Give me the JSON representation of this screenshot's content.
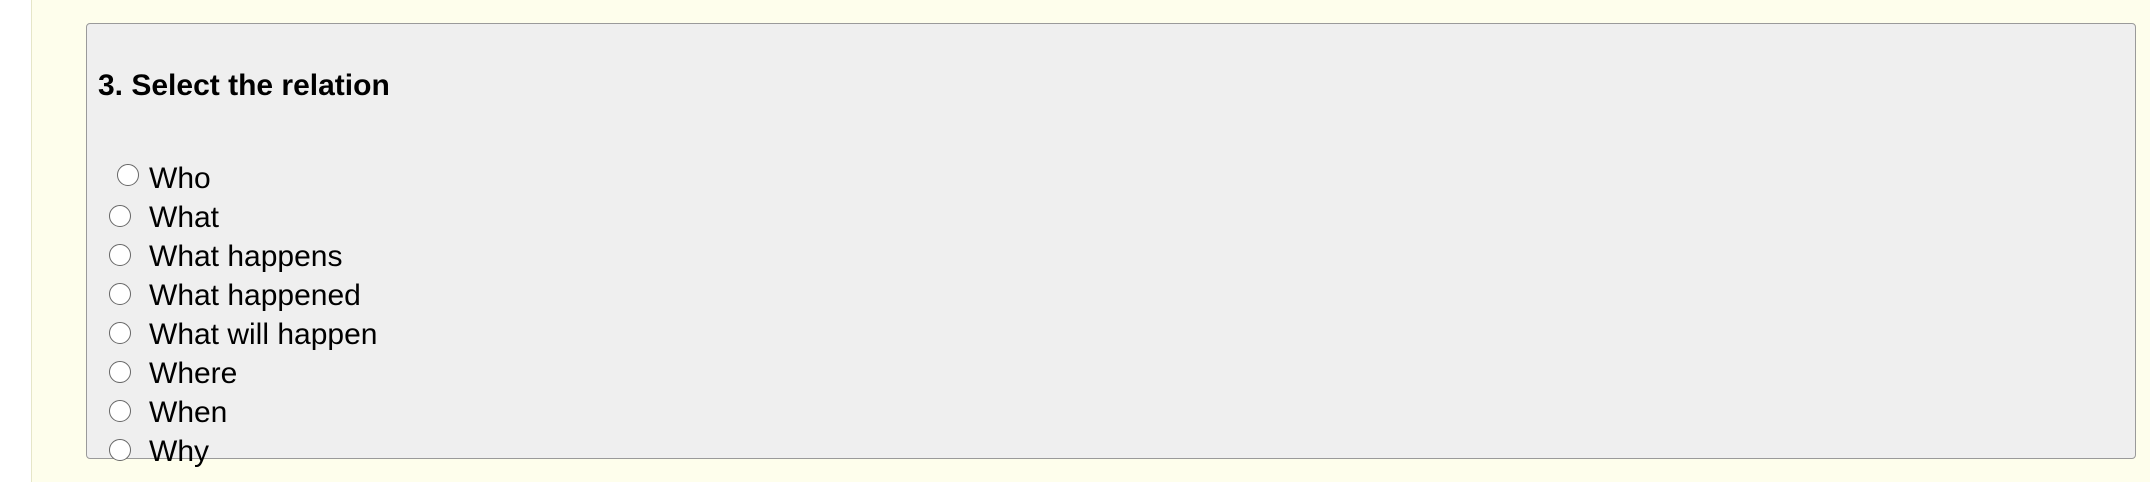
{
  "question": {
    "title": "3. Select the relation",
    "options": [
      {
        "label": "Who",
        "selected": false
      },
      {
        "label": "What",
        "selected": false
      },
      {
        "label": "What happens",
        "selected": false
      },
      {
        "label": "What happened",
        "selected": false
      },
      {
        "label": "What will happen",
        "selected": false
      },
      {
        "label": "Where",
        "selected": false
      },
      {
        "label": "When",
        "selected": false
      },
      {
        "label": "Why",
        "selected": false
      }
    ]
  },
  "colors": {
    "page_background": "#fefeec",
    "box_background": "#efefef",
    "box_border": "#9a9a9a"
  }
}
